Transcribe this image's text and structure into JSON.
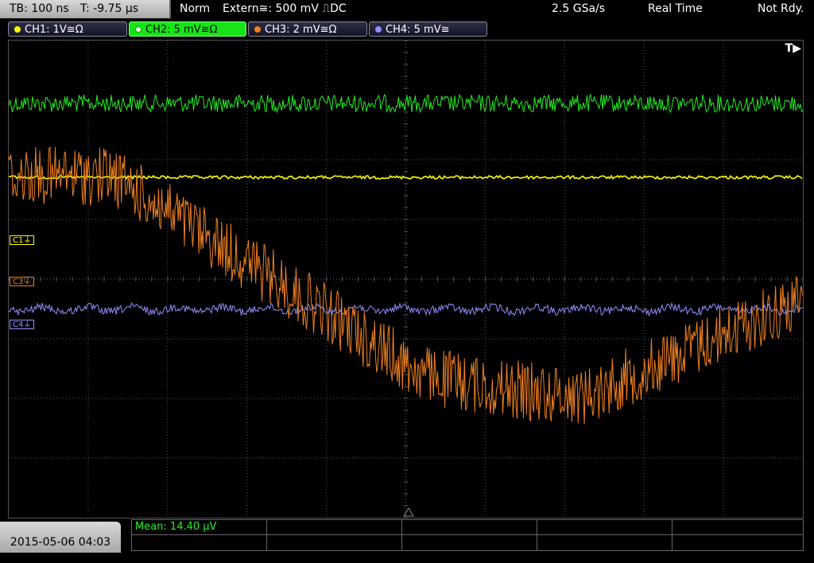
{
  "header": {
    "timebase": "TB: 100 ns",
    "trigger_time": "T: -9.75 µs",
    "trigger_mode": "Norm",
    "trigger_source": "Extern≅: 500 mV ⎍DC",
    "sample_rate": "2.5 GSa/s",
    "acq_mode": "Real Time",
    "status": "Not Rdy."
  },
  "channels": [
    {
      "label": "CH1: 1V≅Ω",
      "color": "#ffff00"
    },
    {
      "label": "CH2: 5 mV≅Ω",
      "color": "#22ee22"
    },
    {
      "label": "CH3: 2 mV≅Ω",
      "color": "#f08020"
    },
    {
      "label": "CH4: 5 mV≅",
      "color": "#9090ff"
    }
  ],
  "screen": {
    "trigger_marker": "T▶",
    "ref_labels": [
      "C1⏚",
      "C3⏚",
      "C4⏚"
    ]
  },
  "footer": {
    "datetime": "2015-05-06 04:03",
    "measurement": "Mean: 14.40 µV"
  },
  "colors": {
    "ch1": "#ffff00",
    "ch2": "#22ee22",
    "ch3": "#f08020",
    "ch4": "#9090ff",
    "grid": "#555555"
  }
}
